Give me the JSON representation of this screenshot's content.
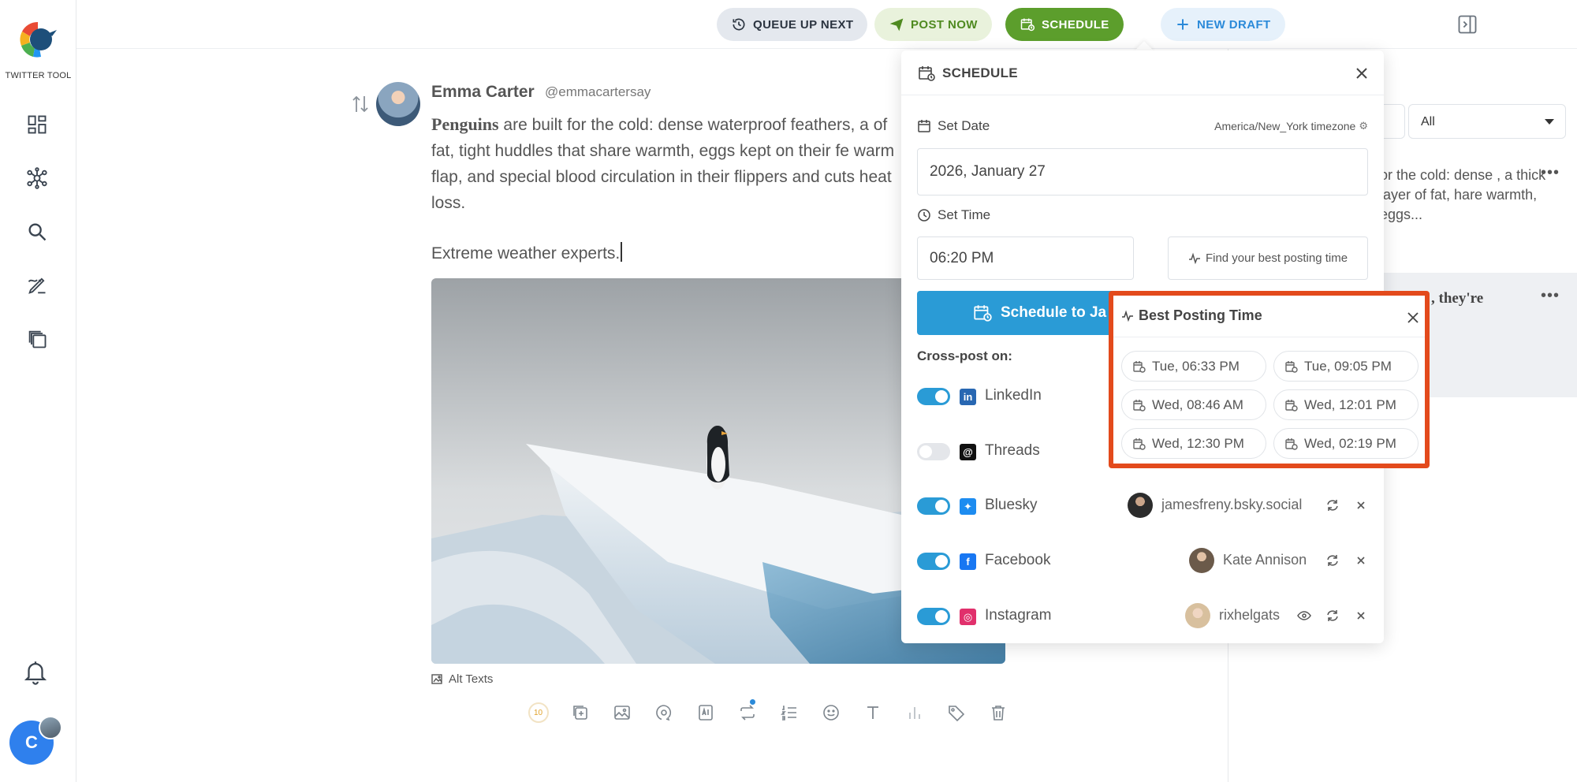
{
  "app": {
    "logo_text": "TWITTER TOOL",
    "user_initial": "C"
  },
  "topbar": {
    "queue_label": "QUEUE UP NEXT",
    "post_now_label": "POST NOW",
    "schedule_label": "SCHEDULE",
    "new_draft_label": "NEW DRAFT"
  },
  "right_panel": {
    "filter_value": "All",
    "drafts": [
      {
        "text": "or the cold: dense , a thick layer of fat, hare warmth, eggs..."
      },
      {
        "text": ", they're"
      }
    ]
  },
  "composer": {
    "author_name": "Emma Carter",
    "author_handle": "@emmacartersay",
    "text_bold": "Penguins",
    "text_rest": " are built for the cold: dense waterproof feathers, a of fat, tight huddles that share warmth, eggs kept on their fe warm flap, and special blood circulation in their flippers and cuts heat loss.",
    "text_second": "Extreme weather experts.",
    "alt_texts_label": "Alt Texts",
    "char_counter": "10",
    "toolbar_icons": [
      "counter-icon",
      "add-thread-icon",
      "image-icon",
      "gif-icon",
      "ai-icon",
      "retweet-icon",
      "numbered-list-icon",
      "emoji-icon",
      "text-format-icon",
      "poll-icon",
      "tag-icon",
      "delete-icon"
    ]
  },
  "schedule": {
    "title": "SCHEDULE",
    "set_date_label": "Set Date",
    "timezone": "America/New_York timezone",
    "date_value": "2026, January 27",
    "set_time_label": "Set Time",
    "time_value": "06:20 PM",
    "best_time_button": "Find your best posting time",
    "schedule_button": "Schedule to Ja",
    "crosspost_label": "Cross-post on:",
    "crosspost": [
      {
        "network": "LinkedIn",
        "enabled": true,
        "account": ""
      },
      {
        "network": "Threads",
        "enabled": false,
        "account": ""
      },
      {
        "network": "Bluesky",
        "enabled": true,
        "account": "jamesfreny.bsky.social"
      },
      {
        "network": "Facebook",
        "enabled": true,
        "account": "Kate Annison"
      },
      {
        "network": "Instagram",
        "enabled": true,
        "account": "rixhelgats"
      }
    ],
    "colors": {
      "accent": "#2a9bd6",
      "highlight": "#e34a1c",
      "schedule_green": "#5c9e2c"
    }
  },
  "best_posting": {
    "title": "Best Posting Time",
    "slots": [
      "Tue, 06:33 PM",
      "Tue, 09:05 PM",
      "Wed, 08:46 AM",
      "Wed, 12:01 PM",
      "Wed, 12:30 PM",
      "Wed, 02:19 PM"
    ]
  }
}
